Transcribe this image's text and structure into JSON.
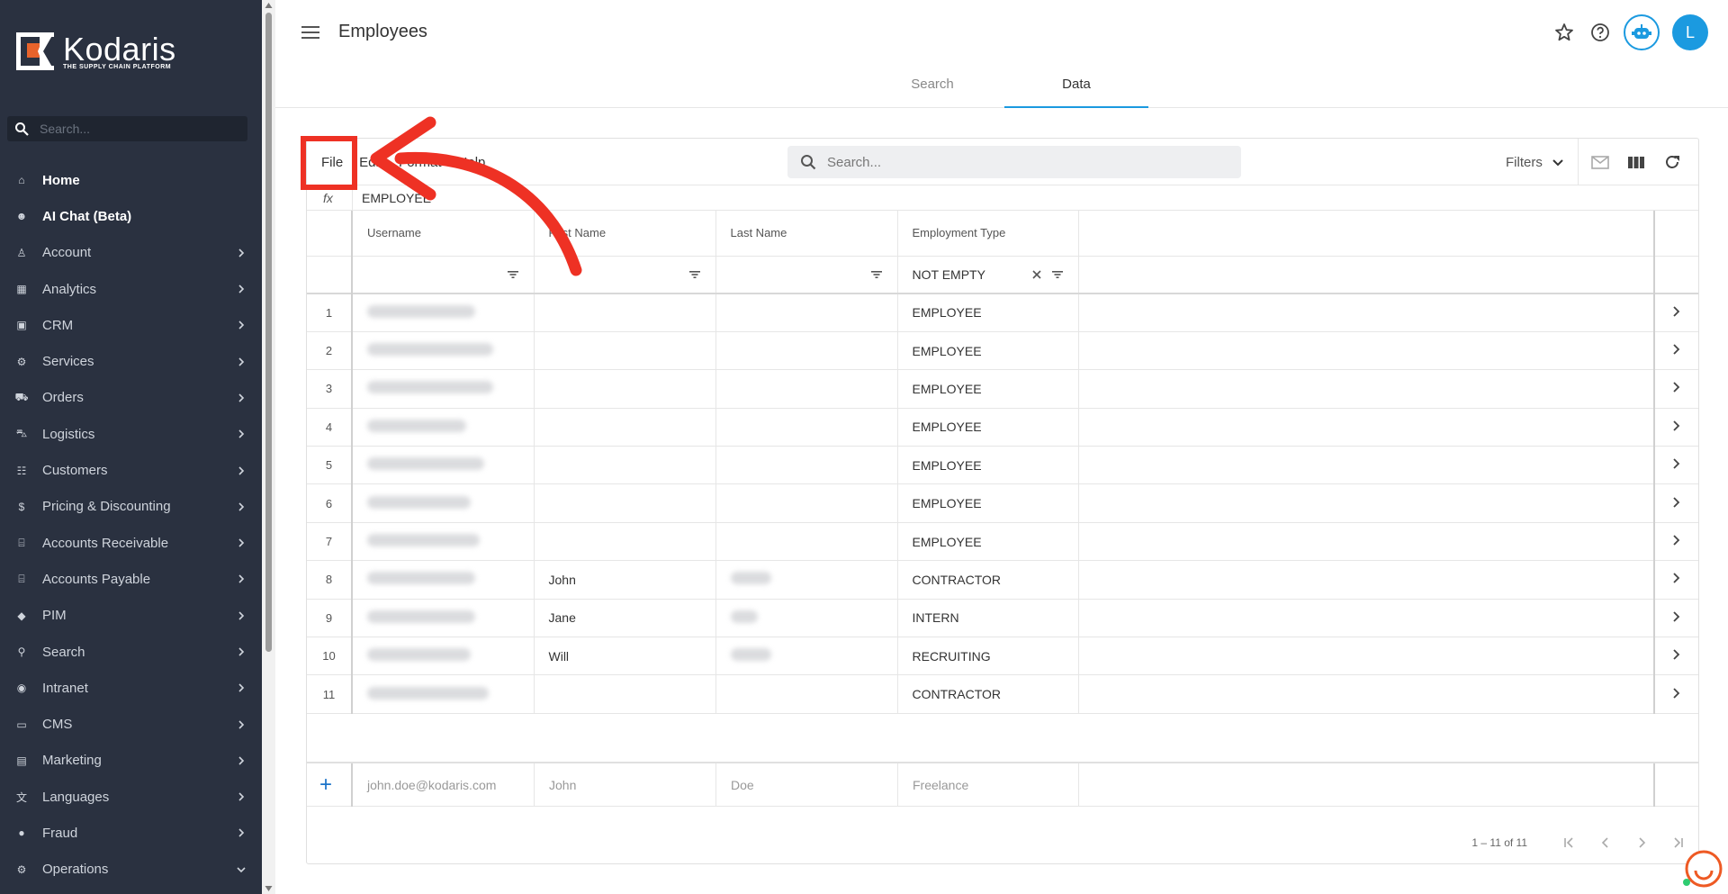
{
  "brand": {
    "name": "Kodaris",
    "tagline": "THE SUPPLY CHAIN PLATFORM"
  },
  "sidebar": {
    "search_placeholder": "Search...",
    "items": [
      {
        "label": "Home",
        "icon": "home-icon",
        "bold": true,
        "chevron": ""
      },
      {
        "label": "AI Chat (Beta)",
        "icon": "robot-icon",
        "bold": true,
        "chevron": ""
      },
      {
        "label": "Account",
        "icon": "person-icon",
        "chevron": "right"
      },
      {
        "label": "Analytics",
        "icon": "analytics-icon",
        "chevron": "right"
      },
      {
        "label": "CRM",
        "icon": "contact-card-icon",
        "chevron": "right"
      },
      {
        "label": "Services",
        "icon": "gears-icon",
        "chevron": "right"
      },
      {
        "label": "Orders",
        "icon": "truck-icon",
        "chevron": "right"
      },
      {
        "label": "Logistics",
        "icon": "car-icon",
        "chevron": "right"
      },
      {
        "label": "Customers",
        "icon": "group-icon",
        "chevron": "right"
      },
      {
        "label": "Pricing & Discounting",
        "icon": "dollar-icon",
        "chevron": "right"
      },
      {
        "label": "Accounts Receivable",
        "icon": "bank-icon",
        "chevron": "right"
      },
      {
        "label": "Accounts Payable",
        "icon": "bank-icon",
        "chevron": "right"
      },
      {
        "label": "PIM",
        "icon": "tag-icon",
        "chevron": "right"
      },
      {
        "label": "Search",
        "icon": "search-icon",
        "chevron": "right"
      },
      {
        "label": "Intranet",
        "icon": "globe-icon",
        "chevron": "right"
      },
      {
        "label": "CMS",
        "icon": "browser-icon",
        "chevron": "right"
      },
      {
        "label": "Marketing",
        "icon": "newspaper-icon",
        "chevron": "right"
      },
      {
        "label": "Languages",
        "icon": "translate-icon",
        "chevron": "right"
      },
      {
        "label": "Fraud",
        "icon": "alert-icon",
        "chevron": "right"
      },
      {
        "label": "Operations",
        "icon": "cog-icon",
        "chevron": "down"
      }
    ]
  },
  "header": {
    "title": "Employees",
    "avatar_initial": "L",
    "tabs": [
      {
        "label": "Search",
        "active": false
      },
      {
        "label": "Data",
        "active": true
      }
    ]
  },
  "grid": {
    "menu": [
      "File",
      "Edit",
      "Format",
      "Help"
    ],
    "search_placeholder": "Search...",
    "filters_label": "Filters",
    "fx_label": "fx",
    "fx_value": "EMPLOYEE",
    "columns": [
      "Username",
      "First Name",
      "Last Name",
      "Employment Type"
    ],
    "filter_value": "NOT EMPTY",
    "rows": [
      {
        "n": "1",
        "first": "",
        "last": "",
        "type": "EMPLOYEE"
      },
      {
        "n": "2",
        "first": "",
        "last": "",
        "type": "EMPLOYEE"
      },
      {
        "n": "3",
        "first": "",
        "last": "",
        "type": "EMPLOYEE"
      },
      {
        "n": "4",
        "first": "",
        "last": "",
        "type": "EMPLOYEE"
      },
      {
        "n": "5",
        "first": "",
        "last": "",
        "type": "EMPLOYEE"
      },
      {
        "n": "6",
        "first": "",
        "last": "",
        "type": "EMPLOYEE"
      },
      {
        "n": "7",
        "first": "",
        "last": "",
        "type": "EMPLOYEE"
      },
      {
        "n": "8",
        "first": "John",
        "last": "",
        "type": "CONTRACTOR"
      },
      {
        "n": "9",
        "first": "Jane",
        "last": "",
        "type": "INTERN"
      },
      {
        "n": "10",
        "first": "Will",
        "last": "",
        "type": "RECRUITING"
      },
      {
        "n": "11",
        "first": "",
        "last": "",
        "type": "CONTRACTOR"
      }
    ],
    "new_row": {
      "username_placeholder": "john.doe@kodaris.com",
      "first_placeholder": "John",
      "last_placeholder": "Doe",
      "type_placeholder": "Freelance"
    },
    "pagination": "1 – 11 of 11"
  },
  "colors": {
    "sidebar_bg": "#2a3140",
    "accent": "#1b9ae0",
    "annotation": "#ee3124",
    "brand_orange": "#e8632b"
  }
}
